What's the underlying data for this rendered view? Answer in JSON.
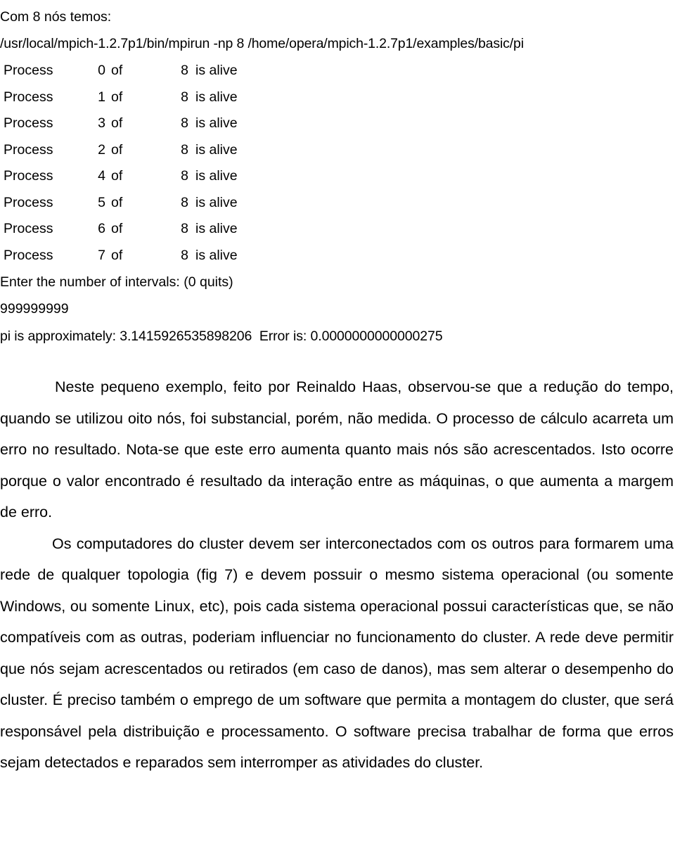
{
  "document": {
    "language": "pt-BR",
    "terminal": {
      "intro_line": "Com 8 nós temos:",
      "command": "/usr/local/mpich-1.2.7p1/bin/mpirun -np 8 /home/opera/mpich-1.2.7p1/examples/basic/pi",
      "process_label": "Process",
      "of_word": "of",
      "state_text": "is alive",
      "total_processes": "8",
      "processes": [
        {
          "label": "Process",
          "rank": "0",
          "of": "of",
          "total": "8",
          "state": "is alive"
        },
        {
          "label": "Process",
          "rank": "1",
          "of": "of",
          "total": "8",
          "state": "is alive"
        },
        {
          "label": "Process",
          "rank": "3",
          "of": "of",
          "total": "8",
          "state": "is alive"
        },
        {
          "label": "Process",
          "rank": "2",
          "of": "of",
          "total": "8",
          "state": "is alive"
        },
        {
          "label": "Process",
          "rank": "4",
          "of": "of",
          "total": "8",
          "state": "is alive"
        },
        {
          "label": "Process",
          "rank": "5",
          "of": "of",
          "total": "8",
          "state": "is alive"
        },
        {
          "label": "Process",
          "rank": "6",
          "of": "of",
          "total": "8",
          "state": "is alive"
        },
        {
          "label": "Process",
          "rank": "7",
          "of": "of",
          "total": "8",
          "state": "is alive"
        }
      ],
      "prompt": "Enter the number of intervals: (0 quits)",
      "user_input": "999999999",
      "result_line": "pi is approximately: 3.1415926535898206  Error is: 0.0000000000000275",
      "pi_value": "3.1415926535898206",
      "error_value": "0.0000000000000275"
    },
    "paragraphs": [
      "Neste pequeno exemplo, feito por Reinaldo Haas, observou-se que a redução do tempo, quando se utilizou oito nós, foi substancial, porém, não medida. O processo de cálculo acarreta um erro no resultado. Nota-se que este erro aumenta quanto mais nós são acrescentados. Isto ocorre porque o valor encontrado é resultado da interação entre as máquinas, o que aumenta a margem de erro.",
      "Os computadores do cluster devem ser interconectados com os outros para formarem uma rede de qualquer topologia (fig 7) e devem possuir o mesmo sistema operacional (ou somente Windows, ou somente Linux, etc), pois cada sistema operacional possui características que, se não compatíveis com as outras, poderiam influenciar no funcionamento do cluster. A rede deve permitir que nós sejam acrescentados ou retirados (em caso de danos), mas sem alterar o desempenho do cluster. É preciso também o emprego de um software que permita a montagem do cluster, que será responsável pela distribuição e processamento. O software precisa trabalhar de forma que erros sejam detectados e reparados sem interromper as atividades do cluster."
    ]
  }
}
